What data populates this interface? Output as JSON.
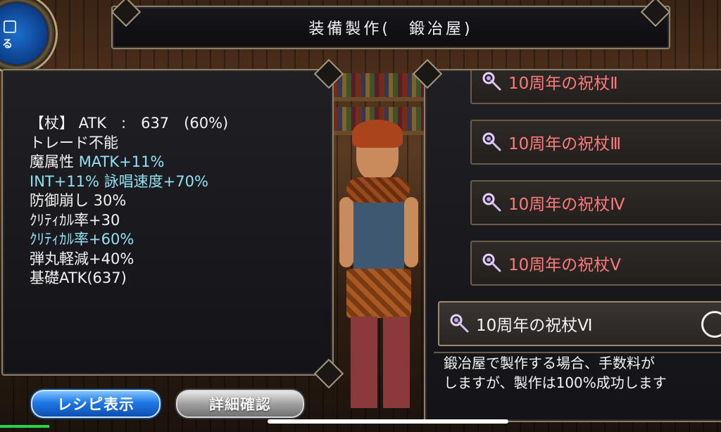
{
  "header": {
    "title": "装備製作(　鍛冶屋)",
    "menu_button_label": "る"
  },
  "stats": {
    "lines": [
      {
        "text": "【杖】 ATK　:　637　(60%)",
        "color": "white"
      },
      {
        "text": "トレード不能",
        "color": "white"
      },
      {
        "text": "魔属性 ",
        "color": "white",
        "extra": "MATK+11%",
        "extra_color": "cyan"
      },
      {
        "text": "INT+11% ",
        "color": "cyan",
        "extra": "詠唱速度+70%",
        "extra_color": "cyan"
      },
      {
        "text": "防御崩し 30%",
        "color": "white"
      },
      {
        "text": "ｸﾘﾃｨｶﾙ率+30",
        "color": "white"
      },
      {
        "text": "ｸﾘﾃｨｶﾙ率+60%",
        "color": "cyan"
      },
      {
        "text": "弾丸軽減+40%",
        "color": "white"
      },
      {
        "text": "基礎ATK(637)",
        "color": "white"
      }
    ]
  },
  "recipes": {
    "items": [
      {
        "label": "10周年の祝杖Ⅱ",
        "selected": false
      },
      {
        "label": "10周年の祝杖Ⅲ",
        "selected": false
      },
      {
        "label": "10周年の祝杖Ⅳ",
        "selected": false
      },
      {
        "label": "10周年の祝杖Ⅴ",
        "selected": false
      },
      {
        "label": "10周年の祝杖Ⅵ",
        "selected": true
      }
    ],
    "description_line1": "鍛冶屋で製作する場合、手数料が",
    "description_line2": "しますが、製作は100%成功します"
  },
  "buttons": {
    "recipe_label": "レシピ表示",
    "details_label": "詳細確認"
  },
  "colors": {
    "stat_white": "#f3f3f3",
    "stat_cyan": "#8fe3f5",
    "recipe_text": "#ff7a7a",
    "accent_blue": "#1f78e6"
  },
  "icons": [
    "staff-icon",
    "radio-circle-icon",
    "menu-icon"
  ]
}
